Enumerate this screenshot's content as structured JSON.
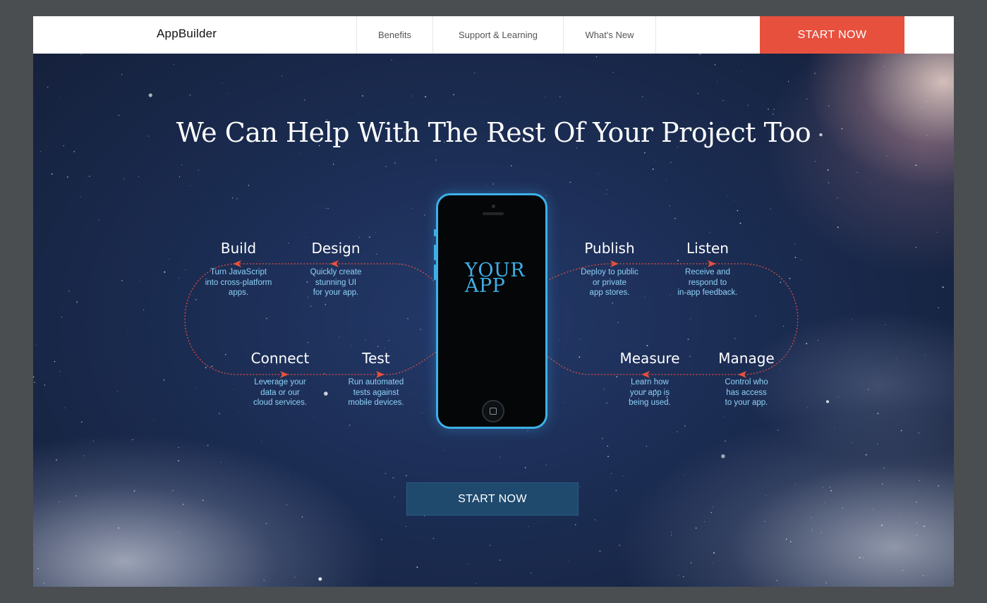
{
  "nav": {
    "logo": "AppBuilder",
    "links": [
      "Benefits",
      "Support & Learning",
      "What's New"
    ],
    "cta_label": "START NOW"
  },
  "hero": {
    "headline": "We Can Help With The Rest Of Your Project Too",
    "phone_text_line1": "YOUR",
    "phone_text_line2": "APP",
    "cta_label": "START NOW",
    "accent_color": "#e8503e",
    "phone_color": "#3eb0e8",
    "step_desc_color": "#8fd2f7"
  },
  "steps": {
    "build": {
      "title": "Build",
      "desc": "Turn JavaScript\ninto cross-platform\napps."
    },
    "design": {
      "title": "Design",
      "desc": "Quickly create\nstunning UI\nfor your app."
    },
    "publish": {
      "title": "Publish",
      "desc": "Deploy to public\nor private\napp stores."
    },
    "listen": {
      "title": "Listen",
      "desc": "Receive and\nrespond to\nin-app feedback."
    },
    "connect": {
      "title": "Connect",
      "desc": "Leverage your\ndata or our\ncloud services."
    },
    "test": {
      "title": "Test",
      "desc": "Run automated\ntests against\nmobile devices."
    },
    "measure": {
      "title": "Measure",
      "desc": "Learn how\nyour app is\nbeing used."
    },
    "manage": {
      "title": "Manage",
      "desc": "Control who\nhas access\nto your app."
    }
  }
}
